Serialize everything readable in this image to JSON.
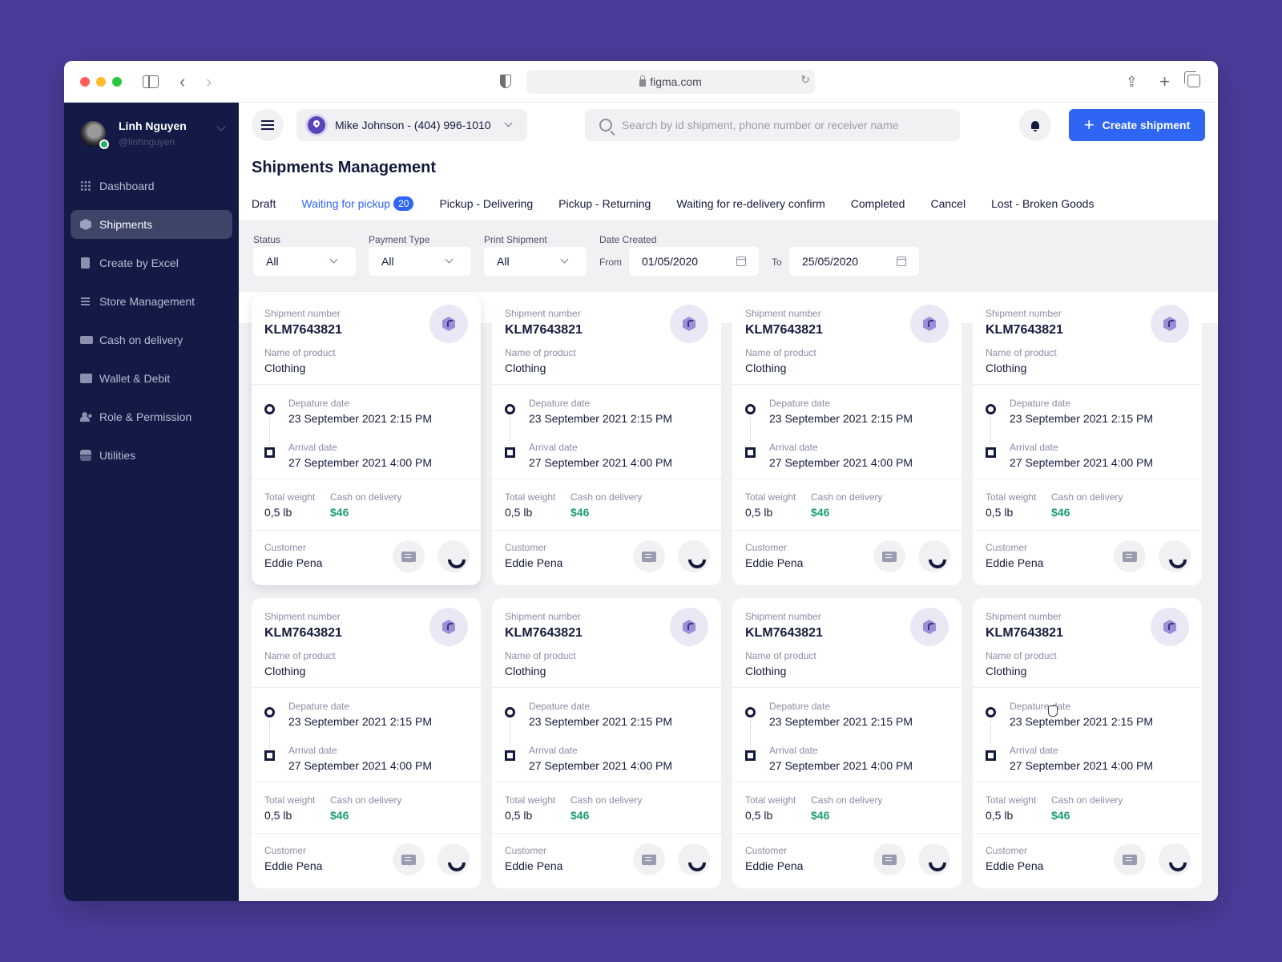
{
  "browser": {
    "url": "figma.com"
  },
  "user": {
    "name": "Linh Nguyen",
    "handle": "@linhnguyen",
    "status_color": "#23b26d"
  },
  "sidebar": {
    "items": [
      {
        "label": "Dashboard",
        "icon": "grid-icon",
        "active": false
      },
      {
        "label": "Shipments",
        "icon": "cube-icon",
        "active": true
      },
      {
        "label": "Create by Excel",
        "icon": "clipboard-icon",
        "active": false
      },
      {
        "label": "Store Management",
        "icon": "building-icon",
        "active": false
      },
      {
        "label": "Cash on delivery",
        "icon": "credit-card-icon",
        "active": false
      },
      {
        "label": "Wallet & Debit",
        "icon": "wallet-icon",
        "active": false
      },
      {
        "label": "Role & Permission",
        "icon": "people-icon",
        "active": false
      },
      {
        "label": "Utilities",
        "icon": "toggle-icon",
        "active": false
      }
    ]
  },
  "header": {
    "store_selector": "Mike Johnson - (404) 996-1010",
    "search_placeholder": "Search by id shipment, phone number or receiver name",
    "create_label": "Create shipment",
    "accent_color": "#2e65f3"
  },
  "page": {
    "title": "Shipments Management",
    "tabs": [
      {
        "label": "Draft",
        "active": false
      },
      {
        "label": "Waiting for pickup",
        "active": true,
        "badge": "20"
      },
      {
        "label": "Pickup - Delivering",
        "active": false
      },
      {
        "label": "Pickup - Returning",
        "active": false
      },
      {
        "label": "Waiting for re-delivery confirm",
        "active": false
      },
      {
        "label": "Completed",
        "active": false
      },
      {
        "label": "Cancel",
        "active": false
      },
      {
        "label": "Lost - Broken Goods",
        "active": false
      }
    ]
  },
  "filters": {
    "status": {
      "label": "Status",
      "value": "All"
    },
    "payment_type": {
      "label": "Payment Type",
      "value": "All"
    },
    "print_shipment": {
      "label": "Print Shipment",
      "value": "All"
    },
    "date_created": {
      "label": "Date Created",
      "from_label": "From",
      "from": "01/05/2020",
      "to_label": "To",
      "to": "25/05/2020"
    }
  },
  "card_labels": {
    "shipment_number": "Shipment number",
    "product": "Name of product",
    "departure": "Depature date",
    "arrival": "Arrival date",
    "weight": "Total weight",
    "cod": "Cash on delivery",
    "customer": "Customer"
  },
  "shipments": [
    {
      "number": "KLM7643821",
      "product": "Clothing",
      "departure": "23 September 2021 2:15 PM",
      "arrival": "27 September 2021 4:00 PM",
      "weight": "0,5 lb",
      "cod": "$46",
      "customer": "Eddie Pena"
    },
    {
      "number": "KLM7643821",
      "product": "Clothing",
      "departure": "23 September 2021 2:15 PM",
      "arrival": "27 September 2021 4:00 PM",
      "weight": "0,5 lb",
      "cod": "$46",
      "customer": "Eddie Pena"
    },
    {
      "number": "KLM7643821",
      "product": "Clothing",
      "departure": "23 September 2021 2:15 PM",
      "arrival": "27 September 2021 4:00 PM",
      "weight": "0,5 lb",
      "cod": "$46",
      "customer": "Eddie Pena"
    },
    {
      "number": "KLM7643821",
      "product": "Clothing",
      "departure": "23 September 2021 2:15 PM",
      "arrival": "27 September 2021 4:00 PM",
      "weight": "0,5 lb",
      "cod": "$46",
      "customer": "Eddie Pena"
    },
    {
      "number": "KLM7643821",
      "product": "Clothing",
      "departure": "23 September 2021 2:15 PM",
      "arrival": "27 September 2021 4:00 PM",
      "weight": "0,5 lb",
      "cod": "$46",
      "customer": "Eddie Pena"
    },
    {
      "number": "KLM7643821",
      "product": "Clothing",
      "departure": "23 September 2021 2:15 PM",
      "arrival": "27 September 2021 4:00 PM",
      "weight": "0,5 lb",
      "cod": "$46",
      "customer": "Eddie Pena"
    },
    {
      "number": "KLM7643821",
      "product": "Clothing",
      "departure": "23 September 2021 2:15 PM",
      "arrival": "27 September 2021 4:00 PM",
      "weight": "0,5 lb",
      "cod": "$46",
      "customer": "Eddie Pena"
    },
    {
      "number": "KLM7643821",
      "product": "Clothing",
      "departure": "23 September 2021 2:15 PM",
      "arrival": "27 September 2021 4:00 PM",
      "weight": "0,5 lb",
      "cod": "$46",
      "customer": "Eddie Pena"
    }
  ]
}
